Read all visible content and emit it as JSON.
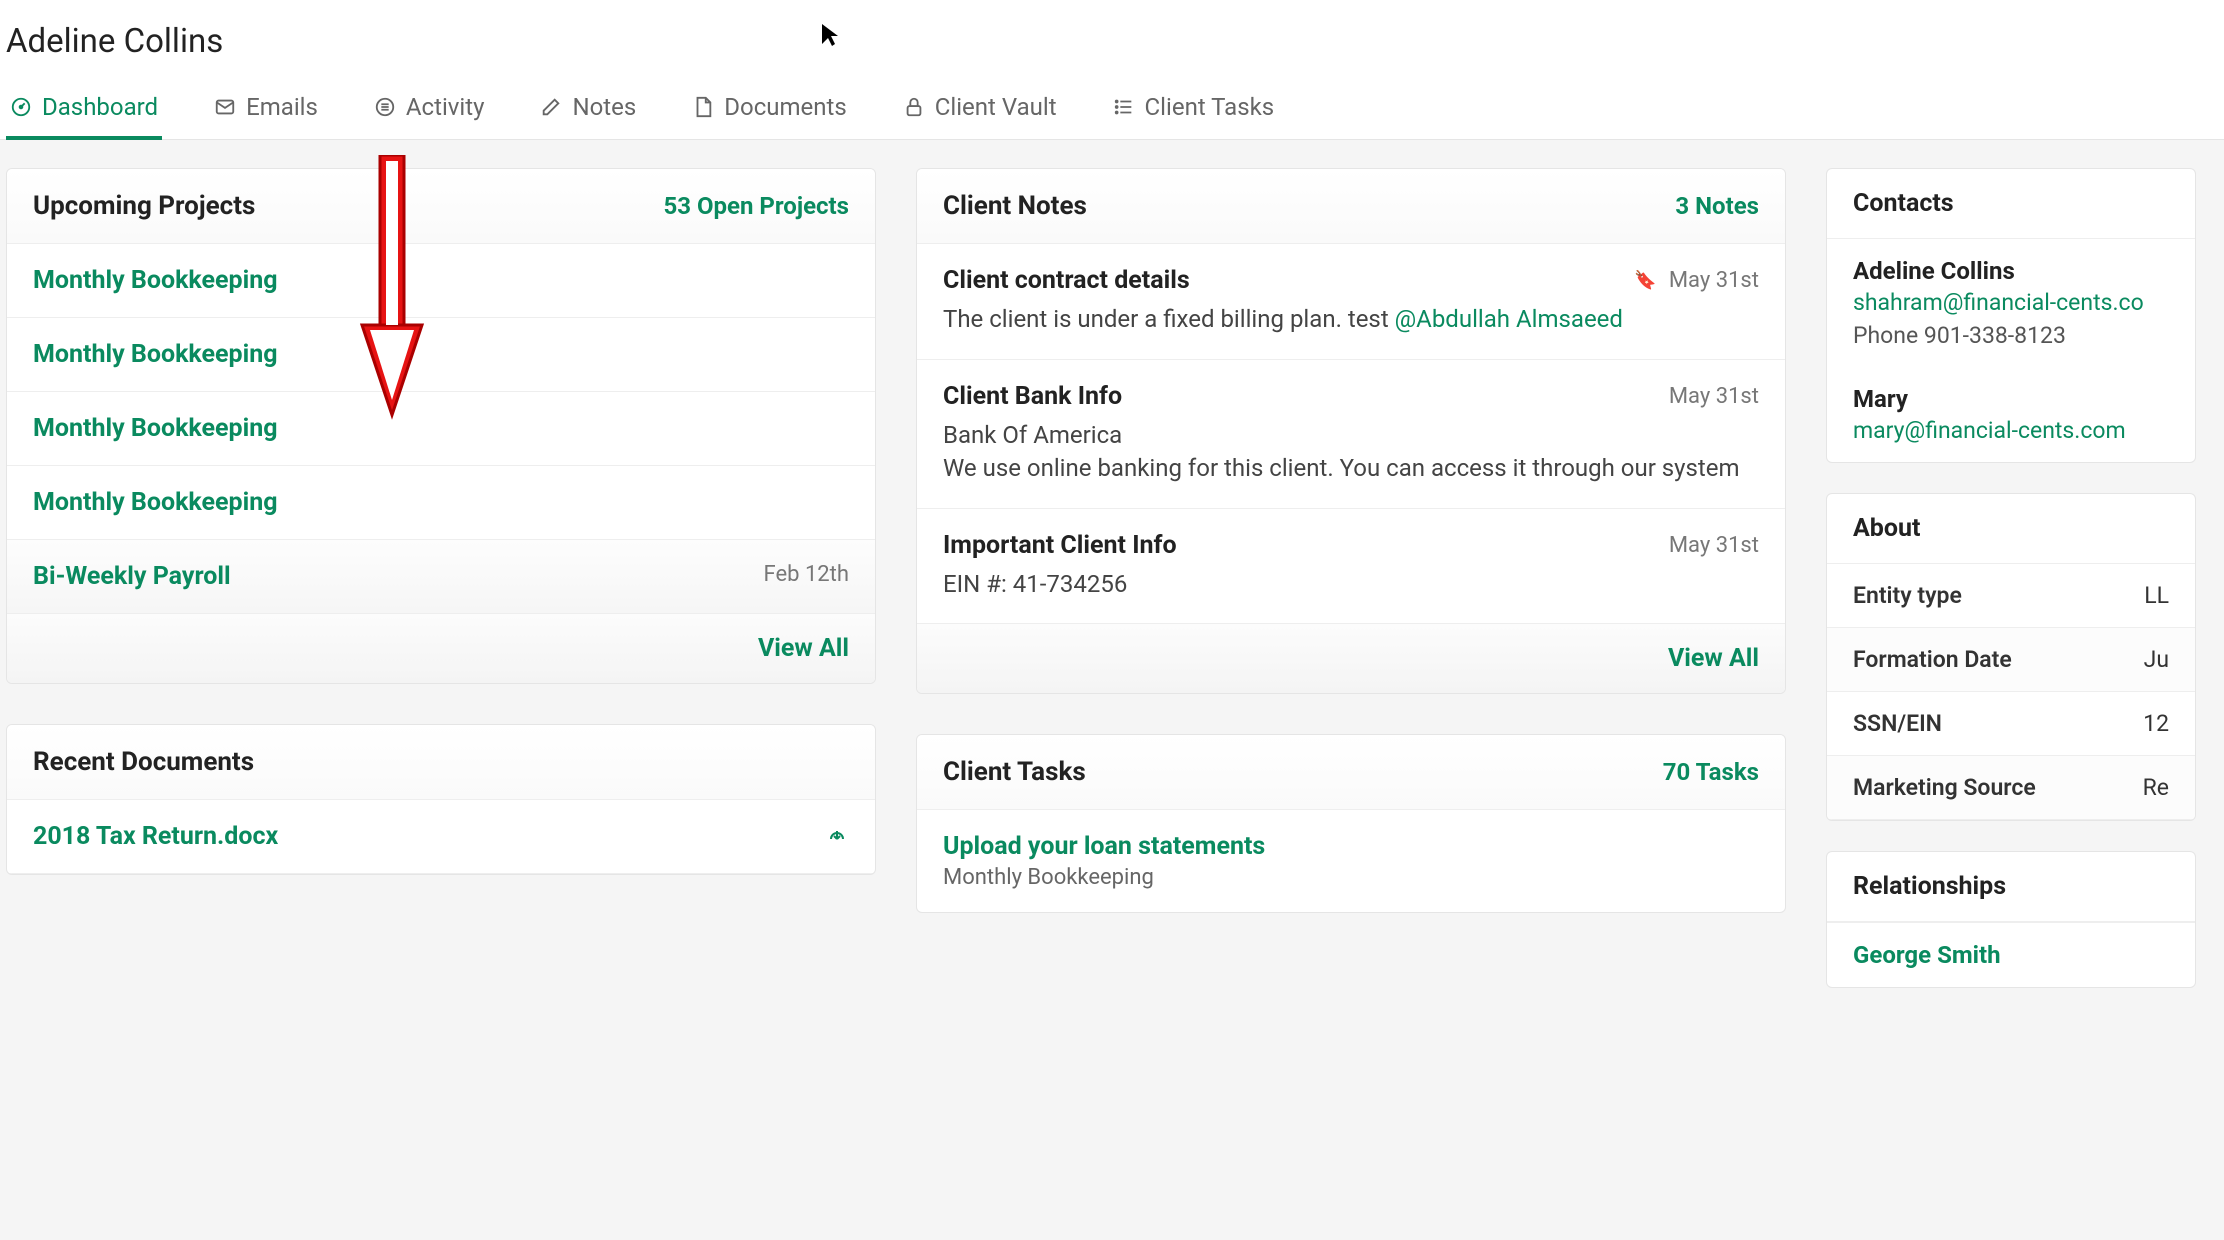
{
  "header": {
    "client_name": "Adeline Collins"
  },
  "tabs": {
    "dashboard": "Dashboard",
    "emails": "Emails",
    "activity": "Activity",
    "notes": "Notes",
    "documents": "Documents",
    "vault": "Client Vault",
    "tasks": "Client Tasks"
  },
  "projects": {
    "title": "Upcoming Projects",
    "badge": "53 Open Projects",
    "items": [
      {
        "name": "Monthly Bookkeeping",
        "date": ""
      },
      {
        "name": "Monthly Bookkeeping",
        "date": ""
      },
      {
        "name": "Monthly Bookkeeping",
        "date": ""
      },
      {
        "name": "Monthly Bookkeeping",
        "date": ""
      },
      {
        "name": "Bi-Weekly Payroll",
        "date": "Feb 12th"
      }
    ],
    "view_all": "View All"
  },
  "recent_docs": {
    "title": "Recent Documents",
    "items": [
      {
        "name": "2018 Tax Return.docx"
      }
    ]
  },
  "notes": {
    "title": "Client Notes",
    "badge": "3 Notes",
    "items": [
      {
        "title": "Client contract details",
        "date": "May 31st",
        "bookmarked": true,
        "body_pre": "The client is under a fixed billing plan. test ",
        "mention": "@Abdullah Almsaeed",
        "body_post": ""
      },
      {
        "title": "Client Bank Info",
        "date": "May 31st",
        "bookmarked": false,
        "body_pre": "Bank Of America",
        "mention": "",
        "body_post": "We use online banking for this client. You can access it through our system"
      },
      {
        "title": "Important Client Info",
        "date": "May 31st",
        "bookmarked": false,
        "body_pre": "EIN #: 41-734256",
        "mention": "",
        "body_post": ""
      }
    ],
    "view_all": "View All"
  },
  "client_tasks": {
    "title": "Client Tasks",
    "badge": "70 Tasks",
    "items": [
      {
        "name": "Upload your loan statements",
        "sub": "Monthly Bookkeeping"
      }
    ]
  },
  "contacts": {
    "title": "Contacts",
    "items": [
      {
        "name": "Adeline Collins",
        "email": "shahram@financial-cents.co",
        "phone": "Phone 901-338-8123"
      },
      {
        "name": "Mary",
        "email": "mary@financial-cents.com",
        "phone": ""
      }
    ]
  },
  "about": {
    "title": "About",
    "rows": [
      {
        "label": "Entity type",
        "value": "LL"
      },
      {
        "label": "Formation Date",
        "value": "Ju"
      },
      {
        "label": "SSN/EIN",
        "value": "12"
      },
      {
        "label": "Marketing Source",
        "value": "Re"
      }
    ]
  },
  "relationships": {
    "title": "Relationships",
    "items": [
      "George Smith"
    ]
  }
}
